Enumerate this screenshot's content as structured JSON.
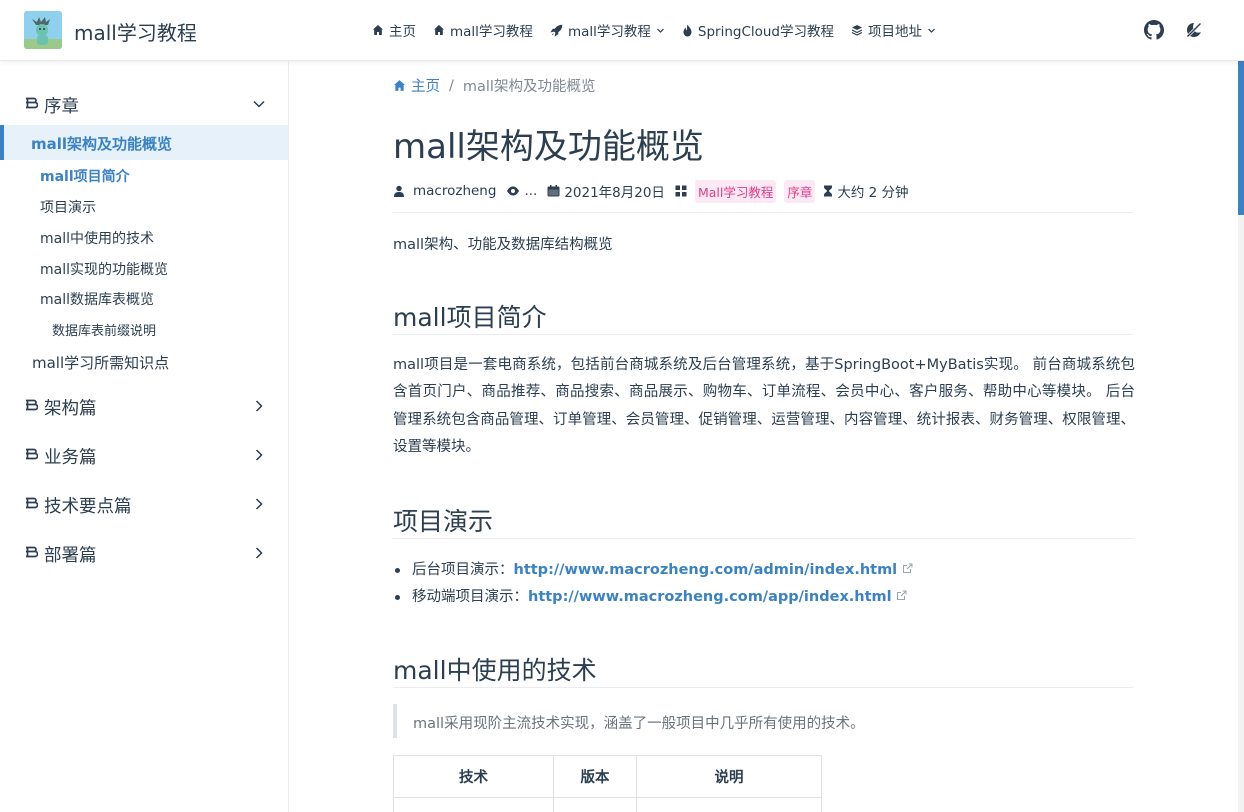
{
  "site": {
    "title": "mall学习教程"
  },
  "nav": {
    "items": [
      {
        "label": "主页",
        "icon": "home-icon"
      },
      {
        "label": "mall学习教程",
        "icon": "home-icon"
      },
      {
        "label": "mall学习教程",
        "icon": "rocket-icon",
        "dropdown": true
      },
      {
        "label": "SpringCloud学习教程",
        "icon": "fire-icon"
      },
      {
        "label": "项目地址",
        "icon": "stack-icon",
        "dropdown": true
      }
    ],
    "right_icons": [
      "github-icon",
      "theme-toggle-icon"
    ]
  },
  "sidebar": {
    "groups": [
      {
        "label": "序章",
        "expanded": true
      },
      {
        "label": "架构篇",
        "expanded": false
      },
      {
        "label": "业务篇",
        "expanded": false
      },
      {
        "label": "技术要点篇",
        "expanded": false
      },
      {
        "label": "部署篇",
        "expanded": false
      }
    ],
    "active_page": "mall架构及功能概览",
    "subitems": [
      {
        "label": "mall项目简介",
        "active": true
      },
      {
        "label": "项目演示"
      },
      {
        "label": "mall中使用的技术"
      },
      {
        "label": "mall实现的功能概览"
      },
      {
        "label": "mall数据库表概览"
      },
      {
        "label": "数据库表前缀说明"
      }
    ],
    "next_page": "mall学习所需知识点"
  },
  "breadcrumb": {
    "home": "主页",
    "current": "mall架构及功能概览"
  },
  "article": {
    "title": "mall架构及功能概览",
    "meta": {
      "author": "macrozheng",
      "views": "...",
      "date": "2021年8月20日",
      "tags": [
        "Mall学习教程",
        "序章"
      ],
      "reading_time": "大约 2 分钟"
    },
    "intro": "mall架构、功能及数据库结构概览",
    "sections": {
      "intro_heading": "mall项目简介",
      "intro_body": "mall项目是一套电商系统，包括前台商城系统及后台管理系统，基于SpringBoot+MyBatis实现。 前台商城系统包含首页门户、商品推荐、商品搜索、商品展示、购物车、订单流程、会员中心、客户服务、帮助中心等模块。 后台管理系统包含商品管理、订单管理、会员管理、促销管理、运营管理、内容管理、统计报表、财务管理、权限管理、设置等模块。",
      "demo_heading": "项目演示",
      "demo_items": [
        {
          "label": "后台项目演示：",
          "link": "http://www.macrozheng.com/admin/index.html"
        },
        {
          "label": "移动端项目演示：",
          "link": "http://www.macrozheng.com/app/index.html"
        }
      ],
      "tech_heading": "mall中使用的技术",
      "tech_quote": "mall采用现阶主流技术实现，涵盖了一般项目中几乎所有使用的技术。",
      "table_headers": [
        "技术",
        "版本",
        "说明"
      ]
    }
  },
  "colors": {
    "accent": "#3b82c4",
    "tag": "#e23c8d",
    "text": "#2c3e50"
  }
}
